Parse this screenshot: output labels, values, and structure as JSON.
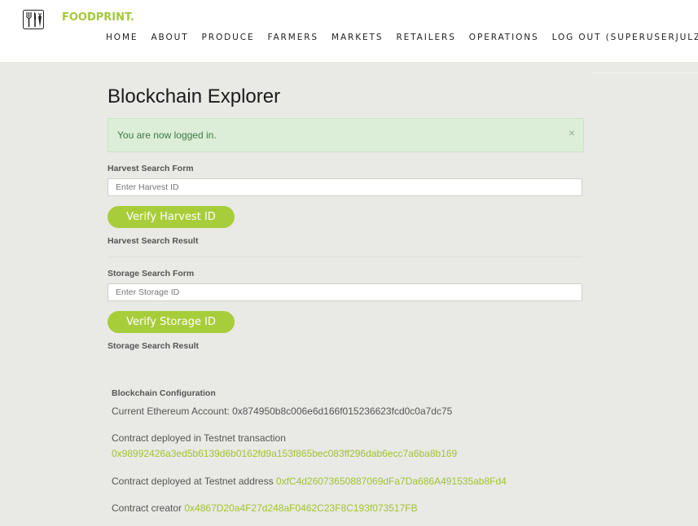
{
  "header": {
    "brand": "FOODPRINT.",
    "nav": [
      "HOME",
      "ABOUT",
      "PRODUCE",
      "FARMERS",
      "MARKETS",
      "RETAILERS",
      "OPERATIONS",
      "LOG OUT (SUPERUSERJULZ)"
    ]
  },
  "page": {
    "title": "Blockchain Explorer",
    "alert": {
      "text": "You are now logged in.",
      "close": "×"
    }
  },
  "harvest": {
    "form_label": "Harvest Search Form",
    "placeholder": "Enter Harvest ID",
    "button": "Verify Harvest ID",
    "result_label": "Harvest Search Result"
  },
  "storage": {
    "form_label": "Storage Search Form",
    "placeholder": "Enter Storage ID",
    "button": "Verify Storage ID",
    "result_label": "Storage Search Result"
  },
  "config": {
    "label": "Blockchain Configuration",
    "account_prefix": "Current Ethereum Account: ",
    "account": "0x874950b8c006e6d166f015236623fcd0c0a7dc75",
    "tx_prefix": "Contract deployed in Testnet transaction",
    "tx": "0x98992426a3ed5b6139d6b0162fd9a153f865bec083ff296dab6ecc7a6ba8b169",
    "address_prefix": "Contract deployed at Testnet address ",
    "address": "0xfC4d26073650887069dFa7Da686A491535ab8Fd4",
    "creator_prefix": "Contract creator ",
    "creator": "0x4867D20a4F27d248aF0462C23F8C193f073517FB"
  },
  "colors": {
    "accent": "#a8cd3a",
    "alert_bg": "#dceed8",
    "alert_text": "#3c7a43",
    "background": "#e9e9e5"
  },
  "icons": {
    "logo": "fork-knife-carrot-icon",
    "close": "close-icon"
  }
}
